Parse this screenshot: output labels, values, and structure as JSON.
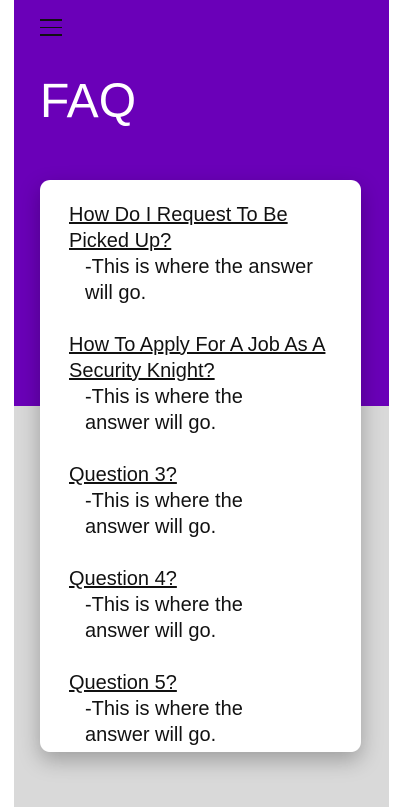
{
  "header": {
    "title": "FAQ",
    "menu_icon": "hamburger-menu-icon"
  },
  "colors": {
    "hero_background": "#6a00b8",
    "page_background": "#d9d9d9",
    "card_background": "#ffffff",
    "text": "#111111"
  },
  "faq": {
    "items": [
      {
        "question": "How Do I Request To Be Picked Up?",
        "answer": "-This is where the answer will go."
      },
      {
        "question": "How To Apply For A Job As A Security Knight?",
        "answer": "-This is where the answer will go."
      },
      {
        "question": "Question 3?",
        "answer": "-This is where the answer will go."
      },
      {
        "question": "Question 4?",
        "answer": "-This is where the answer will go."
      },
      {
        "question": "Question 5?",
        "answer": "-This is where the answer will go."
      }
    ]
  }
}
